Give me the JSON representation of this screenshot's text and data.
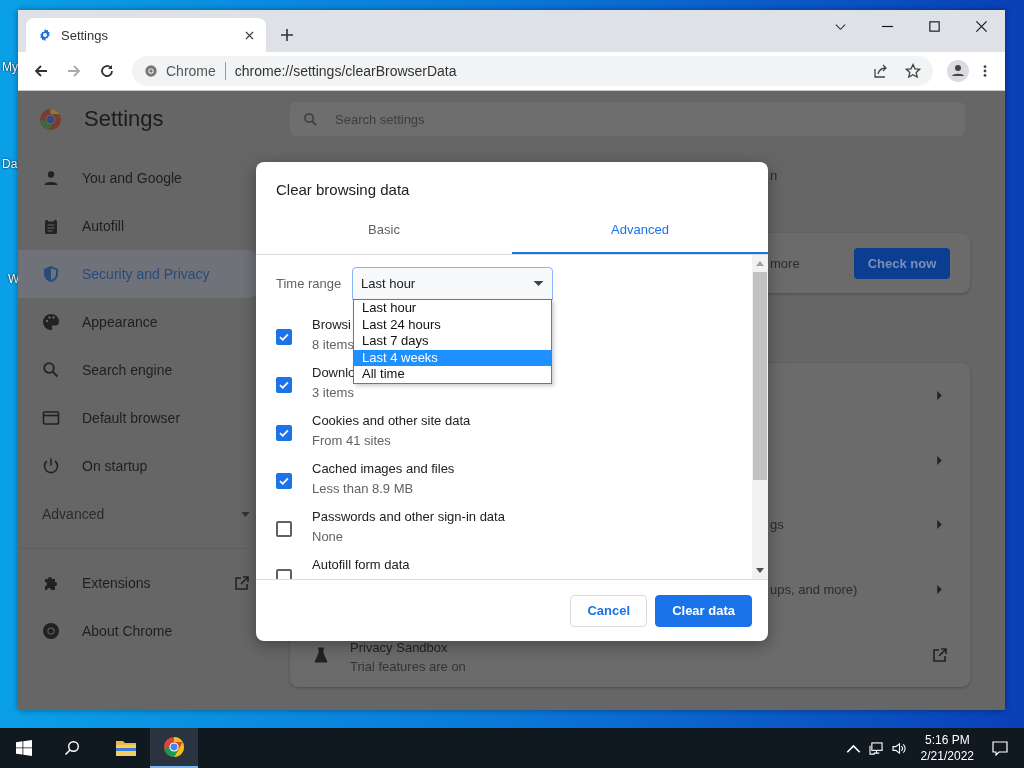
{
  "desktop_icons": [
    {
      "label": "My"
    },
    {
      "label": "Da"
    },
    {
      "label": "W"
    }
  ],
  "browser": {
    "tabs": [
      {
        "title": "Settings",
        "selected": true
      }
    ],
    "omnibox": {
      "chip": "Chrome",
      "url": "chrome://settings/clearBrowserData"
    }
  },
  "settings": {
    "title": "Settings",
    "search": {
      "placeholder": "Search settings"
    },
    "nav": [
      {
        "label": "You and Google",
        "selected": false
      },
      {
        "label": "Autofill",
        "selected": false
      },
      {
        "label": "Security and Privacy",
        "selected": true
      },
      {
        "label": "Appearance",
        "selected": false
      },
      {
        "label": "Search engine",
        "selected": false
      },
      {
        "label": "Default browser",
        "selected": false
      },
      {
        "label": "On startup",
        "selected": false
      }
    ],
    "advanced": {
      "label": "Advanced",
      "expanded": false
    },
    "nav_bottom": [
      {
        "label": "Extensions",
        "kind": "external"
      },
      {
        "label": "About Chrome",
        "kind": "plain"
      }
    ],
    "top_fragment": "n",
    "safety_check": {
      "text": "more",
      "button": "Check now"
    },
    "privacy_rows": [
      {
        "kind": "arrow"
      },
      {
        "kind": "arrow"
      },
      {
        "kind": "arrow",
        "text": "gs"
      },
      {
        "kind": "arrow",
        "text": "ups, and more)"
      },
      {
        "kind": "external",
        "title": "Privacy Sandbox",
        "subtitle": "Trial features are on"
      }
    ]
  },
  "dialog": {
    "title": "Clear browsing data",
    "tabs": [
      {
        "label": "Basic",
        "selected": false
      },
      {
        "label": "Advanced",
        "selected": true
      }
    ],
    "time_range": {
      "label": "Time range",
      "value": "Last hour",
      "open": true,
      "options": [
        {
          "label": "Last hour",
          "highlighted": false
        },
        {
          "label": "Last 24 hours",
          "highlighted": false
        },
        {
          "label": "Last 7 days",
          "highlighted": false
        },
        {
          "label": "Last 4 weeks",
          "highlighted": true
        },
        {
          "label": "All time",
          "highlighted": false
        }
      ]
    },
    "items": [
      {
        "label": "Browsi",
        "detail": "8 items",
        "checked": true
      },
      {
        "label": "Downlo",
        "detail": "3 items",
        "checked": true
      },
      {
        "label": "Cookies and other site data",
        "detail": "From 41 sites",
        "checked": true
      },
      {
        "label": "Cached images and files",
        "detail": "Less than 8.9 MB",
        "checked": true
      },
      {
        "label": "Passwords and other sign-in data",
        "detail": "None",
        "checked": false
      },
      {
        "label": "Autofill form data",
        "checked": false
      }
    ],
    "buttons": [
      {
        "label": "Cancel",
        "kind": "secondary"
      },
      {
        "label": "Clear data",
        "kind": "primary"
      }
    ]
  },
  "taskbar": {
    "apps": [
      {
        "active": false
      },
      {
        "active": true
      }
    ],
    "time": "5:16 PM",
    "date": "2/21/2022"
  }
}
